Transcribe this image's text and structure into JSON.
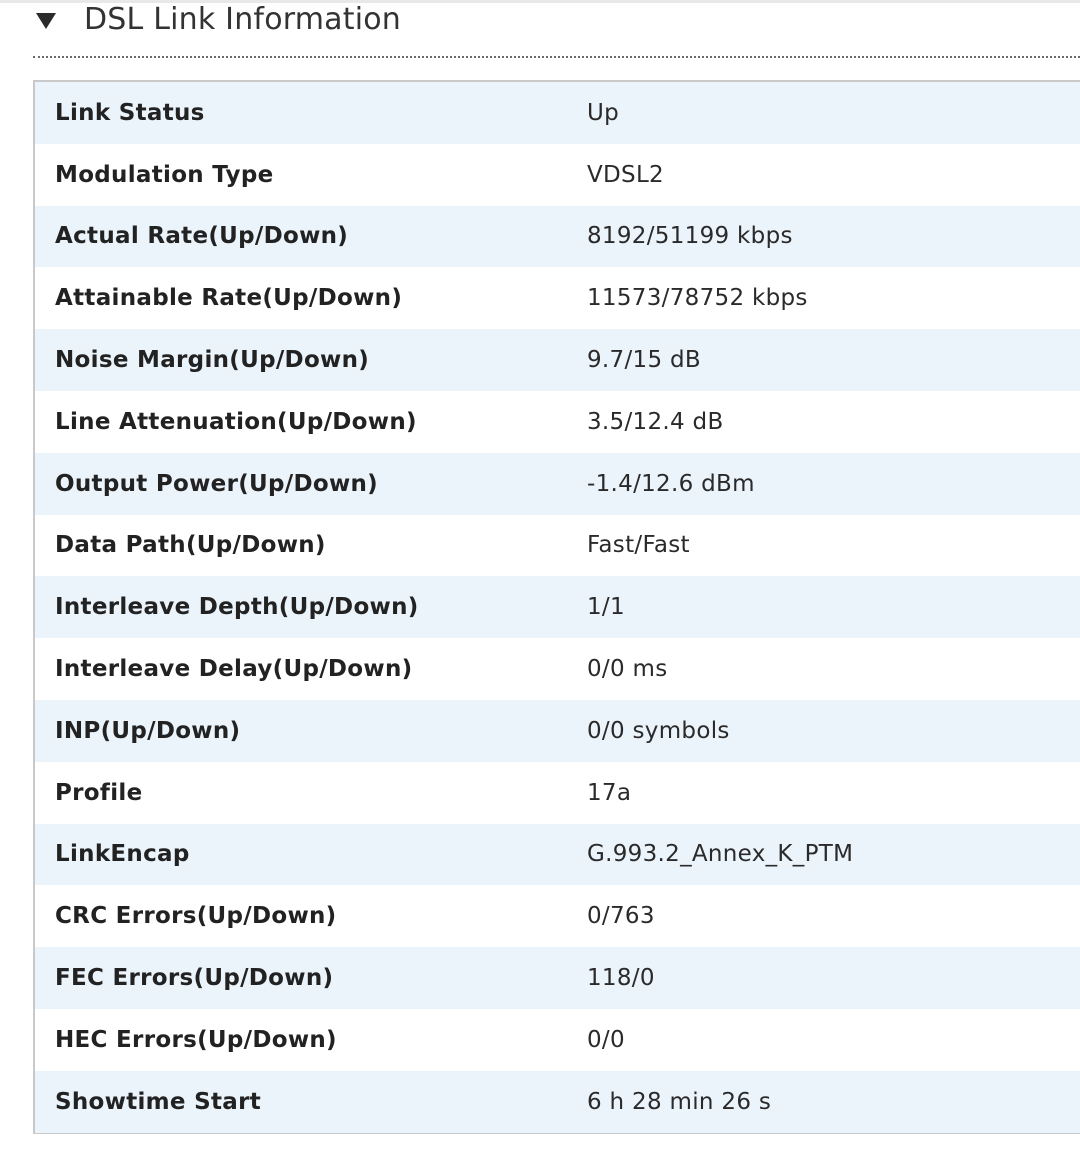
{
  "section": {
    "title": "DSL Link Information",
    "icon": "caret-down-icon"
  },
  "rows": [
    {
      "label": "Link Status",
      "value": "Up"
    },
    {
      "label": "Modulation Type",
      "value": "VDSL2"
    },
    {
      "label": "Actual Rate(Up/Down)",
      "value": "8192/51199 kbps"
    },
    {
      "label": "Attainable Rate(Up/Down)",
      "value": "11573/78752 kbps"
    },
    {
      "label": "Noise Margin(Up/Down)",
      "value": "9.7/15 dB"
    },
    {
      "label": "Line Attenuation(Up/Down)",
      "value": "3.5/12.4 dB"
    },
    {
      "label": "Output Power(Up/Down)",
      "value": "-1.4/12.6 dBm"
    },
    {
      "label": "Data Path(Up/Down)",
      "value": "Fast/Fast"
    },
    {
      "label": "Interleave Depth(Up/Down)",
      "value": "1/1"
    },
    {
      "label": "Interleave Delay(Up/Down)",
      "value": "0/0 ms"
    },
    {
      "label": "INP(Up/Down)",
      "value": "0/0 symbols"
    },
    {
      "label": "Profile",
      "value": "17a"
    },
    {
      "label": "LinkEncap",
      "value": "G.993.2_Annex_K_PTM"
    },
    {
      "label": "CRC Errors(Up/Down)",
      "value": "0/763"
    },
    {
      "label": "FEC Errors(Up/Down)",
      "value": "118/0"
    },
    {
      "label": "HEC Errors(Up/Down)",
      "value": "0/0"
    },
    {
      "label": "Showtime Start",
      "value": "6 h 28 min 26 s"
    }
  ],
  "colors": {
    "row_alt": "#ebf3fb",
    "row_base": "#ffffff",
    "border": "#c9c9c9"
  }
}
